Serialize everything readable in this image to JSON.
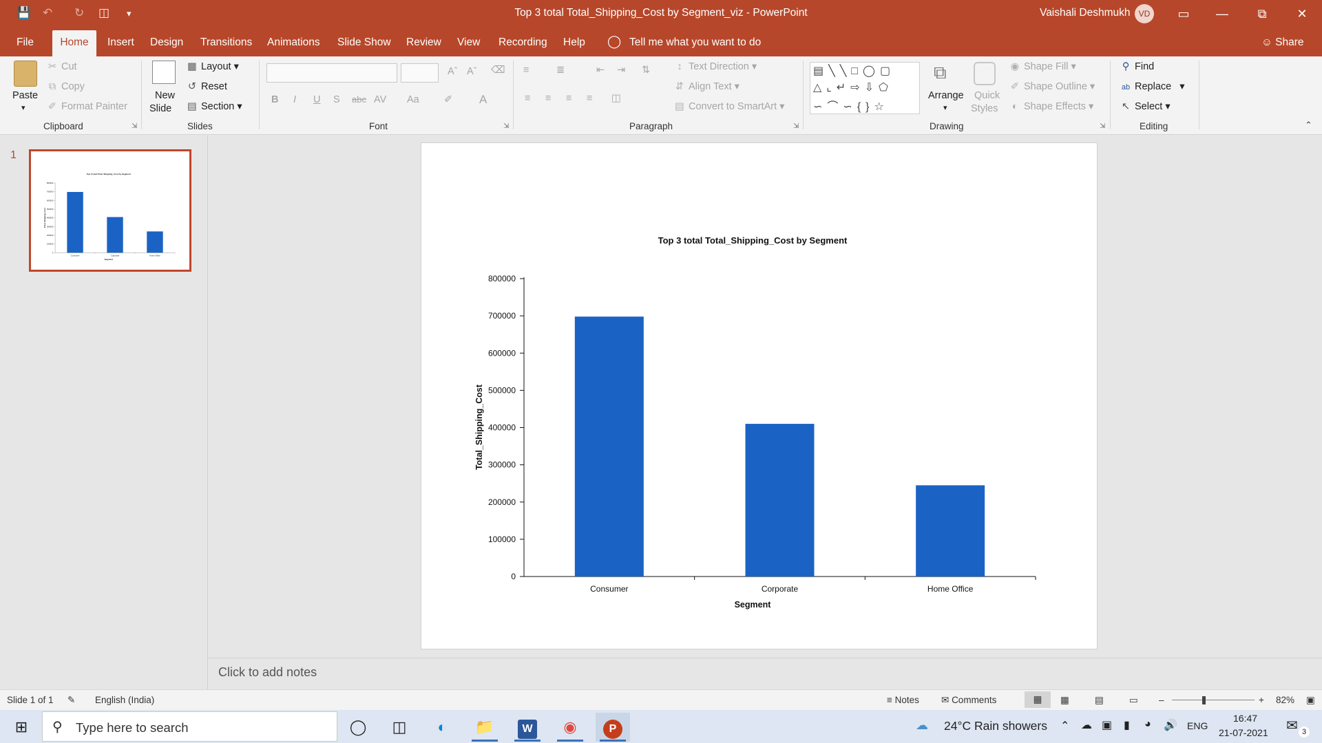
{
  "window": {
    "title": "Top 3 total Total_Shipping_Cost by Segment_viz  -  PowerPoint",
    "user_name": "Vaishali Deshmukh",
    "user_initials": "VD",
    "accent_color": "#b7472a"
  },
  "tabs": [
    "File",
    "Home",
    "Insert",
    "Design",
    "Transitions",
    "Animations",
    "Slide Show",
    "Review",
    "View",
    "Recording",
    "Help"
  ],
  "tell_me": "Tell me what you want to do",
  "share_label": "Share",
  "ribbon": {
    "clipboard": {
      "paste": "Paste",
      "cut": "Cut",
      "copy": "Copy",
      "format_painter": "Format Painter",
      "label": "Clipboard"
    },
    "slides": {
      "new_slide_1": "New",
      "new_slide_2": "Slide",
      "layout": "Layout",
      "reset": "Reset",
      "section": "Section",
      "label": "Slides"
    },
    "font": {
      "label": "Font"
    },
    "paragraph": {
      "text_direction": "Text Direction",
      "align_text": "Align Text",
      "convert": "Convert to SmartArt",
      "label": "Paragraph"
    },
    "drawing": {
      "arrange": "Arrange",
      "quick_1": "Quick",
      "quick_2": "Styles",
      "shape_fill": "Shape Fill",
      "shape_outline": "Shape Outline",
      "shape_effects": "Shape Effects",
      "label": "Drawing"
    },
    "editing": {
      "find": "Find",
      "replace": "Replace",
      "select": "Select",
      "label": "Editing"
    }
  },
  "thumbnail": {
    "number": "1"
  },
  "notes_placeholder": "Click to add notes",
  "chart_data": {
    "type": "bar",
    "title": "Top 3 total Total_Shipping_Cost by Segment",
    "xlabel": "Segment",
    "ylabel": "Total_Shipping_Cost",
    "categories": [
      "Consumer",
      "Corporate",
      "Home Office"
    ],
    "values": [
      698000,
      410000,
      245000
    ],
    "ylim": [
      0,
      800000
    ],
    "yticks": [
      0,
      100000,
      200000,
      300000,
      400000,
      500000,
      600000,
      700000,
      800000
    ],
    "bar_color": "#1a63c4",
    "grid": false
  },
  "status": {
    "slide_of": "Slide 1 of 1",
    "language": "English (India)",
    "notes": "Notes",
    "comments": "Comments",
    "zoom": "82%"
  },
  "taskbar": {
    "search_placeholder": "Type here to search",
    "weather": "24°C  Rain showers",
    "lang": "ENG",
    "time": "16:47",
    "date": "21-07-2021",
    "notif_count": "3"
  }
}
